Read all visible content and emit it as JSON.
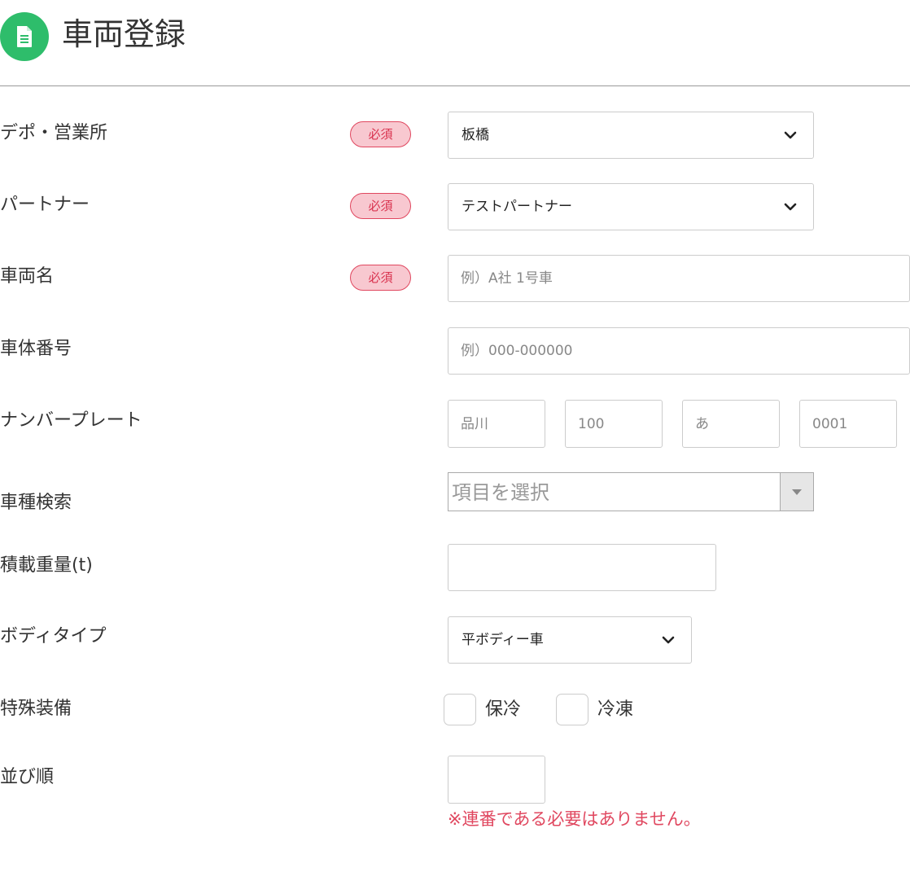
{
  "header": {
    "title": "車両登録",
    "icon": "document-icon",
    "icon_color": "#2ebd6b"
  },
  "required_label": "必須",
  "form": {
    "depot": {
      "label": "デポ・営業所",
      "required": true,
      "value": "板橋"
    },
    "partner": {
      "label": "パートナー",
      "required": true,
      "value": "テストパートナー"
    },
    "vehicle_name": {
      "label": "車両名",
      "required": true,
      "value": "",
      "placeholder": "例）A社 1号車"
    },
    "chassis_number": {
      "label": "車体番号",
      "value": "",
      "placeholder": "例）000-000000"
    },
    "license_plate": {
      "label": "ナンバープレート",
      "region_placeholder": "品川",
      "class_placeholder": "100",
      "kana_placeholder": "あ",
      "number_placeholder": "0001"
    },
    "vehicle_type_search": {
      "label": "車種検索",
      "placeholder": "項目を選択"
    },
    "load_capacity": {
      "label": "積載重量(t)",
      "value": ""
    },
    "body_type": {
      "label": "ボディタイプ",
      "value": "平ボディー車"
    },
    "special_equipment": {
      "label": "特殊装備",
      "options": [
        {
          "label": "保冷",
          "checked": false
        },
        {
          "label": "冷凍",
          "checked": false
        }
      ]
    },
    "sort_order": {
      "label": "並び順",
      "value": "",
      "note": "※連番である必要はありません。"
    }
  },
  "colors": {
    "accent": "#2ebd6b",
    "required_bg": "#f8c8d0",
    "required_text": "#d9334f",
    "note": "#e0475f"
  }
}
